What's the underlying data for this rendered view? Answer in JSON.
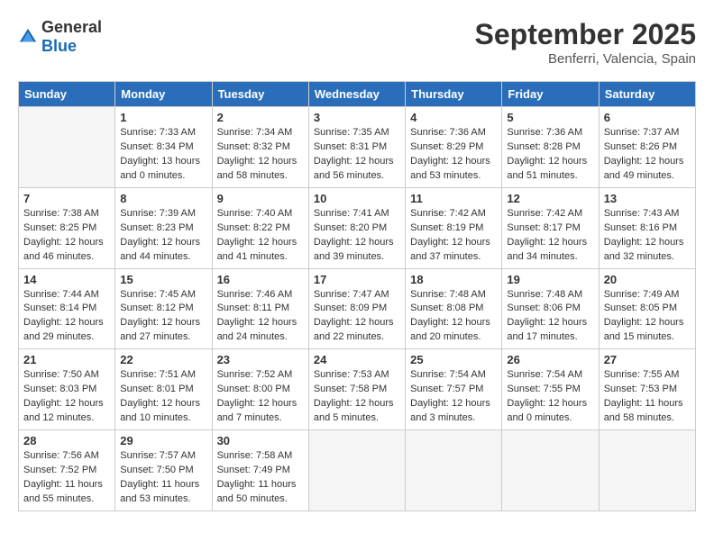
{
  "header": {
    "logo_general": "General",
    "logo_blue": "Blue",
    "month": "September 2025",
    "location": "Benferri, Valencia, Spain"
  },
  "days_of_week": [
    "Sunday",
    "Monday",
    "Tuesday",
    "Wednesday",
    "Thursday",
    "Friday",
    "Saturday"
  ],
  "weeks": [
    [
      {
        "date": "",
        "sunrise": "",
        "sunset": "",
        "daylight": ""
      },
      {
        "date": "1",
        "sunrise": "Sunrise: 7:33 AM",
        "sunset": "Sunset: 8:34 PM",
        "daylight": "Daylight: 13 hours and 0 minutes."
      },
      {
        "date": "2",
        "sunrise": "Sunrise: 7:34 AM",
        "sunset": "Sunset: 8:32 PM",
        "daylight": "Daylight: 12 hours and 58 minutes."
      },
      {
        "date": "3",
        "sunrise": "Sunrise: 7:35 AM",
        "sunset": "Sunset: 8:31 PM",
        "daylight": "Daylight: 12 hours and 56 minutes."
      },
      {
        "date": "4",
        "sunrise": "Sunrise: 7:36 AM",
        "sunset": "Sunset: 8:29 PM",
        "daylight": "Daylight: 12 hours and 53 minutes."
      },
      {
        "date": "5",
        "sunrise": "Sunrise: 7:36 AM",
        "sunset": "Sunset: 8:28 PM",
        "daylight": "Daylight: 12 hours and 51 minutes."
      },
      {
        "date": "6",
        "sunrise": "Sunrise: 7:37 AM",
        "sunset": "Sunset: 8:26 PM",
        "daylight": "Daylight: 12 hours and 49 minutes."
      }
    ],
    [
      {
        "date": "7",
        "sunrise": "Sunrise: 7:38 AM",
        "sunset": "Sunset: 8:25 PM",
        "daylight": "Daylight: 12 hours and 46 minutes."
      },
      {
        "date": "8",
        "sunrise": "Sunrise: 7:39 AM",
        "sunset": "Sunset: 8:23 PM",
        "daylight": "Daylight: 12 hours and 44 minutes."
      },
      {
        "date": "9",
        "sunrise": "Sunrise: 7:40 AM",
        "sunset": "Sunset: 8:22 PM",
        "daylight": "Daylight: 12 hours and 41 minutes."
      },
      {
        "date": "10",
        "sunrise": "Sunrise: 7:41 AM",
        "sunset": "Sunset: 8:20 PM",
        "daylight": "Daylight: 12 hours and 39 minutes."
      },
      {
        "date": "11",
        "sunrise": "Sunrise: 7:42 AM",
        "sunset": "Sunset: 8:19 PM",
        "daylight": "Daylight: 12 hours and 37 minutes."
      },
      {
        "date": "12",
        "sunrise": "Sunrise: 7:42 AM",
        "sunset": "Sunset: 8:17 PM",
        "daylight": "Daylight: 12 hours and 34 minutes."
      },
      {
        "date": "13",
        "sunrise": "Sunrise: 7:43 AM",
        "sunset": "Sunset: 8:16 PM",
        "daylight": "Daylight: 12 hours and 32 minutes."
      }
    ],
    [
      {
        "date": "14",
        "sunrise": "Sunrise: 7:44 AM",
        "sunset": "Sunset: 8:14 PM",
        "daylight": "Daylight: 12 hours and 29 minutes."
      },
      {
        "date": "15",
        "sunrise": "Sunrise: 7:45 AM",
        "sunset": "Sunset: 8:12 PM",
        "daylight": "Daylight: 12 hours and 27 minutes."
      },
      {
        "date": "16",
        "sunrise": "Sunrise: 7:46 AM",
        "sunset": "Sunset: 8:11 PM",
        "daylight": "Daylight: 12 hours and 24 minutes."
      },
      {
        "date": "17",
        "sunrise": "Sunrise: 7:47 AM",
        "sunset": "Sunset: 8:09 PM",
        "daylight": "Daylight: 12 hours and 22 minutes."
      },
      {
        "date": "18",
        "sunrise": "Sunrise: 7:48 AM",
        "sunset": "Sunset: 8:08 PM",
        "daylight": "Daylight: 12 hours and 20 minutes."
      },
      {
        "date": "19",
        "sunrise": "Sunrise: 7:48 AM",
        "sunset": "Sunset: 8:06 PM",
        "daylight": "Daylight: 12 hours and 17 minutes."
      },
      {
        "date": "20",
        "sunrise": "Sunrise: 7:49 AM",
        "sunset": "Sunset: 8:05 PM",
        "daylight": "Daylight: 12 hours and 15 minutes."
      }
    ],
    [
      {
        "date": "21",
        "sunrise": "Sunrise: 7:50 AM",
        "sunset": "Sunset: 8:03 PM",
        "daylight": "Daylight: 12 hours and 12 minutes."
      },
      {
        "date": "22",
        "sunrise": "Sunrise: 7:51 AM",
        "sunset": "Sunset: 8:01 PM",
        "daylight": "Daylight: 12 hours and 10 minutes."
      },
      {
        "date": "23",
        "sunrise": "Sunrise: 7:52 AM",
        "sunset": "Sunset: 8:00 PM",
        "daylight": "Daylight: 12 hours and 7 minutes."
      },
      {
        "date": "24",
        "sunrise": "Sunrise: 7:53 AM",
        "sunset": "Sunset: 7:58 PM",
        "daylight": "Daylight: 12 hours and 5 minutes."
      },
      {
        "date": "25",
        "sunrise": "Sunrise: 7:54 AM",
        "sunset": "Sunset: 7:57 PM",
        "daylight": "Daylight: 12 hours and 3 minutes."
      },
      {
        "date": "26",
        "sunrise": "Sunrise: 7:54 AM",
        "sunset": "Sunset: 7:55 PM",
        "daylight": "Daylight: 12 hours and 0 minutes."
      },
      {
        "date": "27",
        "sunrise": "Sunrise: 7:55 AM",
        "sunset": "Sunset: 7:53 PM",
        "daylight": "Daylight: 11 hours and 58 minutes."
      }
    ],
    [
      {
        "date": "28",
        "sunrise": "Sunrise: 7:56 AM",
        "sunset": "Sunset: 7:52 PM",
        "daylight": "Daylight: 11 hours and 55 minutes."
      },
      {
        "date": "29",
        "sunrise": "Sunrise: 7:57 AM",
        "sunset": "Sunset: 7:50 PM",
        "daylight": "Daylight: 11 hours and 53 minutes."
      },
      {
        "date": "30",
        "sunrise": "Sunrise: 7:58 AM",
        "sunset": "Sunset: 7:49 PM",
        "daylight": "Daylight: 11 hours and 50 minutes."
      },
      {
        "date": "",
        "sunrise": "",
        "sunset": "",
        "daylight": ""
      },
      {
        "date": "",
        "sunrise": "",
        "sunset": "",
        "daylight": ""
      },
      {
        "date": "",
        "sunrise": "",
        "sunset": "",
        "daylight": ""
      },
      {
        "date": "",
        "sunrise": "",
        "sunset": "",
        "daylight": ""
      }
    ]
  ]
}
